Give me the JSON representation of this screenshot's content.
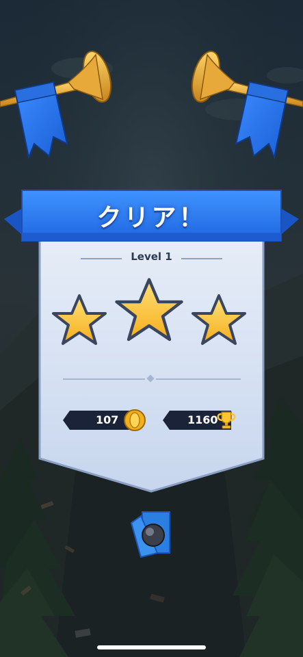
{
  "title": "クリア！",
  "level_label": "Level 1",
  "stars": {
    "earned": 3,
    "total": 3
  },
  "rewards": {
    "coins": "107",
    "trophies": "1160"
  },
  "icons": [
    "trumpet-icon",
    "banner-flag-icon",
    "star-icon",
    "coin-icon",
    "trophy-icon",
    "orb-card-icon"
  ],
  "colors": {
    "banner_blue": "#2f7ef0",
    "panel_light": "#dbe6f5",
    "star_gold": "#ffc83a",
    "pill_dark": "#1a2338"
  }
}
